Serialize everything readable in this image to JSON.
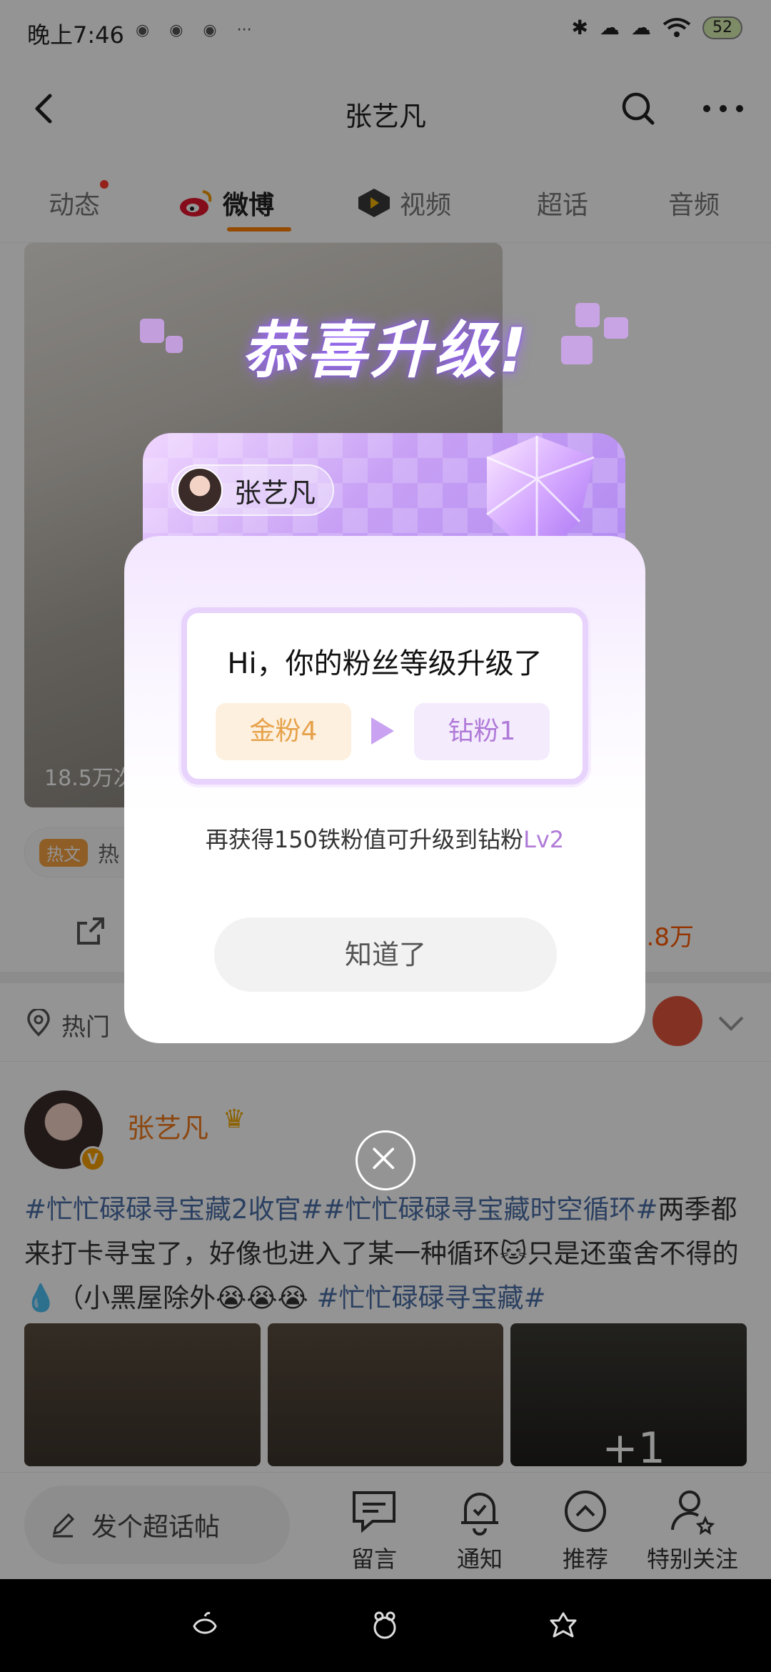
{
  "status_bar": {
    "time": "晚上7:46",
    "more": "···",
    "battery": "52"
  },
  "header": {
    "title": "张艺凡"
  },
  "tabs": [
    {
      "label": "动态"
    },
    {
      "label": "微博"
    },
    {
      "label": "视频"
    },
    {
      "label": "超话"
    },
    {
      "label": "音频"
    }
  ],
  "feed": {
    "video_views": "18.5万次",
    "hot_badge": "热文",
    "hot_chip_text": "热",
    "like_count": ".8万",
    "hot_section_label": "热门"
  },
  "post": {
    "author": "张艺凡",
    "verify": "V",
    "text_parts": [
      "#忙忙碌碌寻宝藏2收官##忙忙碌碌寻宝藏时空循环#",
      "两季都来打卡寻宝了，好像也进入了某一种循环🐱只是还蛮舍不得的💧（小黑屋除外😭😭😭",
      "#忙忙碌碌寻宝藏#"
    ],
    "more_images": "+1"
  },
  "bottom_bar": {
    "compose": "发个超话帖",
    "actions": [
      {
        "label": "留言"
      },
      {
        "label": "通知"
      },
      {
        "label": "推荐"
      },
      {
        "label": "特别关注"
      }
    ]
  },
  "dialog": {
    "title": "恭喜升级!",
    "star_name": "张艺凡",
    "message": "Hi，你的粉丝等级升级了",
    "level_from": "金粉4",
    "level_to": "钻粉1",
    "hint_prefix": "再获得150铁粉值可升级到钻粉",
    "hint_level": "Lv2",
    "ok_label": "知道了"
  },
  "colors": {
    "accent": "#ff8200",
    "purple": "#b07ad8",
    "link": "#4a6ea8"
  }
}
